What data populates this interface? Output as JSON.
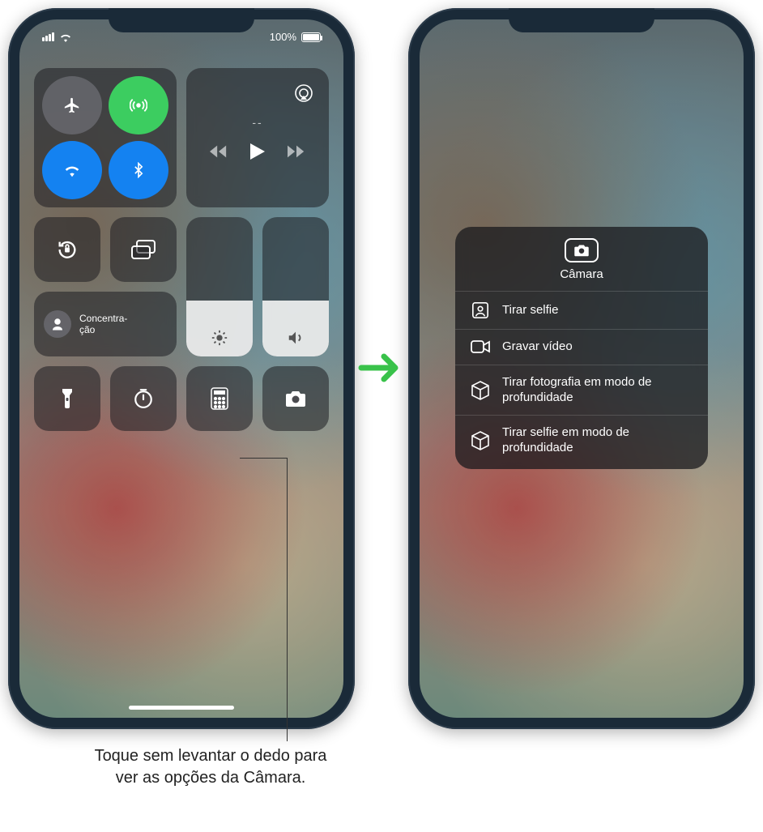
{
  "status": {
    "battery_pct": "100%"
  },
  "connectivity": {
    "airplane": "airplane-mode",
    "cellular": "cellular-data",
    "wifi": "wifi",
    "bluetooth": "bluetooth"
  },
  "media": {
    "title": "--"
  },
  "focus": {
    "label": "Concentra-\nção"
  },
  "camera_menu": {
    "title": "Câmara",
    "items": [
      {
        "icon": "selfie",
        "label": "Tirar selfie"
      },
      {
        "icon": "video",
        "label": "Gravar vídeo"
      },
      {
        "icon": "cube",
        "label": "Tirar fotografia em modo de profundidade"
      },
      {
        "icon": "cube",
        "label": "Tirar selfie em modo de profundidade"
      }
    ]
  },
  "callout": "Toque sem levantar o dedo para ver as opções da Câmara."
}
